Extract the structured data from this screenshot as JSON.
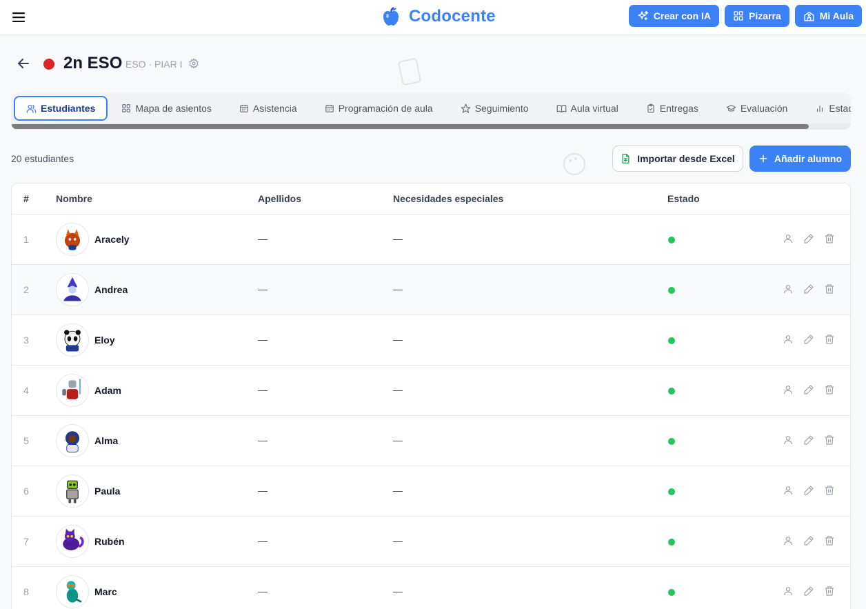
{
  "app": {
    "name": "Codocente"
  },
  "topbar": {
    "buttons": [
      {
        "label": "Crear con IA",
        "icon": "sparkles-icon"
      },
      {
        "label": "Pizarra",
        "icon": "grid-icon"
      },
      {
        "label": "Mi Aula",
        "icon": "school-icon"
      }
    ]
  },
  "header": {
    "title": "2n ESO",
    "subtitle": "ESO · PIAR I",
    "dot_color": "#dc2626"
  },
  "tabs": [
    {
      "label": "Estudiantes",
      "icon": "users-icon",
      "active": true
    },
    {
      "label": "Mapa de asientos",
      "icon": "grid-icon"
    },
    {
      "label": "Asistencia",
      "icon": "calendar-icon"
    },
    {
      "label": "Programación de aula",
      "icon": "calendar-icon"
    },
    {
      "label": "Seguimiento",
      "icon": "star-icon"
    },
    {
      "label": "Aula virtual",
      "icon": "book-icon"
    },
    {
      "label": "Entregas",
      "icon": "clipboard-check-icon"
    },
    {
      "label": "Evaluación",
      "icon": "graduation-cap-icon"
    },
    {
      "label": "Estad",
      "icon": "bar-chart-icon"
    }
  ],
  "toolbar": {
    "count": "20 estudiantes",
    "import_label": "Importar desde Excel",
    "add_label": "Añadir alumno"
  },
  "table": {
    "columns": [
      "#",
      "Nombre",
      "Apellidos",
      "Necesidades especiales",
      "Estado"
    ],
    "rows": [
      {
        "num": "1",
        "name": "Aracely",
        "apellidos": "—",
        "necesidades": "—",
        "avatar": "fox-avatar",
        "hover": false
      },
      {
        "num": "2",
        "name": "Andrea",
        "apellidos": "—",
        "necesidades": "—",
        "avatar": "wizard-avatar",
        "hover": true
      },
      {
        "num": "3",
        "name": "Eloy",
        "apellidos": "—",
        "necesidades": "—",
        "avatar": "panda-avatar",
        "hover": false
      },
      {
        "num": "4",
        "name": "Adam",
        "apellidos": "—",
        "necesidades": "—",
        "avatar": "knight-avatar",
        "hover": false
      },
      {
        "num": "5",
        "name": "Alma",
        "apellidos": "—",
        "necesidades": "—",
        "avatar": "astronaut-avatar",
        "hover": false
      },
      {
        "num": "6",
        "name": "Paula",
        "apellidos": "—",
        "necesidades": "—",
        "avatar": "robot-avatar",
        "hover": false
      },
      {
        "num": "7",
        "name": "Rubén",
        "apellidos": "—",
        "necesidades": "—",
        "avatar": "cat-avatar",
        "hover": false
      },
      {
        "num": "8",
        "name": "Marc",
        "apellidos": "—",
        "necesidades": "—",
        "avatar": "dino-avatar",
        "hover": false
      }
    ],
    "status_color": "#22c55e"
  }
}
